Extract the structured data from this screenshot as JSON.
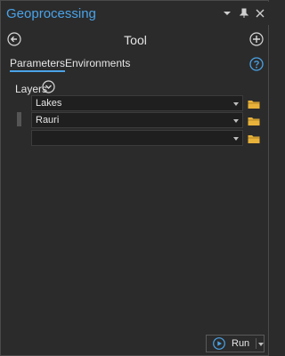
{
  "window": {
    "title": "Geoprocessing",
    "icons": [
      "chevron-down-icon",
      "pin-icon",
      "close-icon"
    ]
  },
  "header": {
    "title": "Tool",
    "back_icon": "back-arrow-icon",
    "add_icon": "add-icon"
  },
  "tabs": [
    {
      "label": "Parameters",
      "active": true
    },
    {
      "label": "Environments",
      "active": false
    }
  ],
  "help_icon": "help-icon",
  "layers": {
    "label": "Layers",
    "rows": [
      {
        "value": "Lakes"
      },
      {
        "value": "Rauri"
      },
      {
        "value": ""
      }
    ]
  },
  "run": {
    "label": "Run"
  },
  "colors": {
    "accent": "#4aa3e8",
    "background": "#2b2b2b",
    "folder": "#e8b23a"
  }
}
